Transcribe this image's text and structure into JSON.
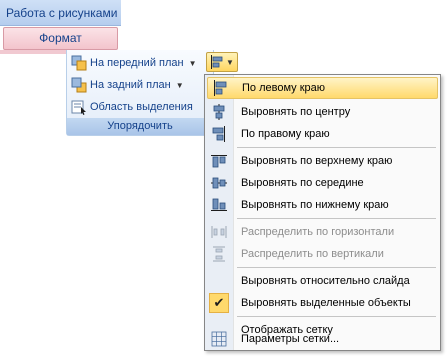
{
  "ribbon": {
    "context_header": "Работа с рисунками",
    "context_tab": "Формат",
    "group": {
      "items": [
        {
          "label": "На передний план",
          "icon": "bring-forward-icon",
          "has_dropdown": true
        },
        {
          "label": "На задний план",
          "icon": "send-backward-icon",
          "has_dropdown": true
        },
        {
          "label": "Область выделения",
          "icon": "selection-pane-icon",
          "has_dropdown": false
        }
      ],
      "label": "Упорядочить"
    },
    "align_button": {
      "icon": "align-left-icon",
      "has_dropdown": true
    }
  },
  "menu": {
    "items": [
      {
        "label": "По левому краю",
        "icon": "align-left-icon",
        "highlighted": true,
        "disabled": false
      },
      {
        "label": "Выровнять по центру",
        "icon": "align-center-icon",
        "highlighted": false,
        "disabled": false
      },
      {
        "label": "По правому краю",
        "icon": "align-right-icon",
        "highlighted": false,
        "disabled": false
      },
      {
        "label": "Выровнять по верхнему краю",
        "icon": "align-top-icon",
        "highlighted": false,
        "disabled": false
      },
      {
        "label": "Выровнять по середине",
        "icon": "align-middle-icon",
        "highlighted": false,
        "disabled": false
      },
      {
        "label": "Выровнять по нижнему краю",
        "icon": "align-bottom-icon",
        "highlighted": false,
        "disabled": false
      },
      {
        "label": "Распределить по горизонтали",
        "icon": "distribute-horizontal-icon",
        "highlighted": false,
        "disabled": true
      },
      {
        "label": "Распределить по вертикали",
        "icon": "distribute-vertical-icon",
        "highlighted": false,
        "disabled": true
      },
      {
        "label": "Выровнять относительно слайда",
        "icon": "",
        "highlighted": false,
        "disabled": false
      },
      {
        "label": "Выровнять выделенные объекты",
        "icon": "checkmark-icon",
        "checked": true,
        "highlighted": false,
        "disabled": false
      },
      {
        "label": "Отображать сетку",
        "icon": "",
        "highlighted": false,
        "disabled": false
      },
      {
        "label": "Параметры сетки...",
        "icon": "grid-settings-icon",
        "highlighted": false,
        "disabled": false
      }
    ]
  },
  "colors": {
    "accent": "#15428b",
    "highlight": "#ffd96c",
    "context_tab": "#f3c4cc"
  }
}
